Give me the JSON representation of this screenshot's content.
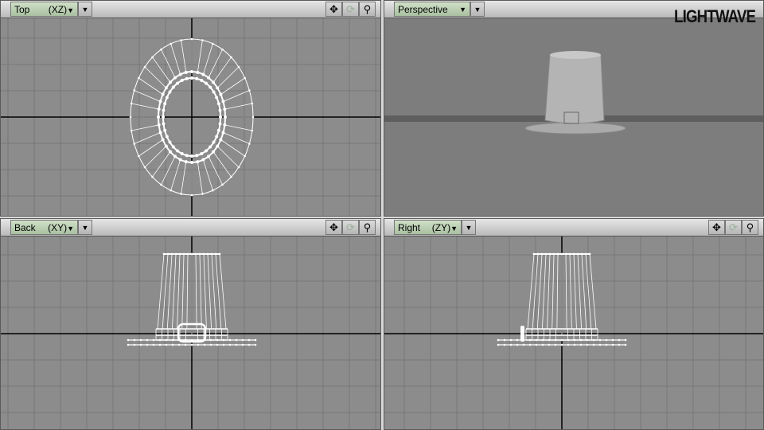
{
  "logo": "LIGHTWAVE",
  "viewports": [
    {
      "view": "Top",
      "axes": "(XZ)"
    },
    {
      "view": "Perspective",
      "axes": ""
    },
    {
      "view": "Back",
      "axes": "(XY)"
    },
    {
      "view": "Right",
      "axes": "(ZY)"
    }
  ],
  "tools": {
    "move": "✥",
    "rotate": "⟳",
    "zoom": "🔍"
  },
  "colors": {
    "viewport_bg": "#8c8c8c",
    "grid": "#7a7a7a",
    "wire": "#ffffff",
    "header": "#c8c8c8",
    "view_button": "#b9ccb2"
  }
}
